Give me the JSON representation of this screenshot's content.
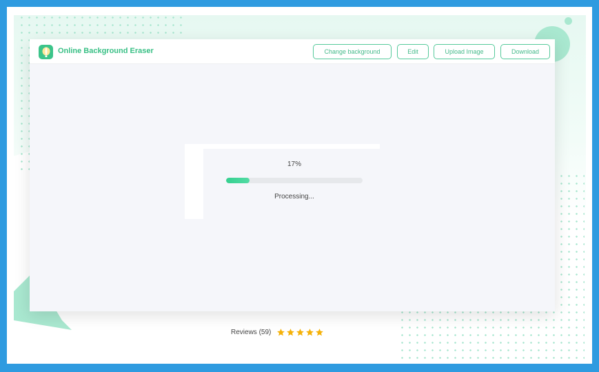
{
  "header": {
    "brand": "Online Background Eraser",
    "buttons": {
      "change_background": "Change background",
      "edit": "Edit",
      "upload_image": "Upload Image",
      "download": "Download"
    }
  },
  "processing": {
    "percent_label": "17%",
    "progress": 0.17,
    "status": "Processing..."
  },
  "reviews": {
    "label": "Reviews (59)",
    "stars": 5
  },
  "colors": {
    "accent": "#3cc48a",
    "frame": "#2f9be0",
    "star": "#f5b20a"
  },
  "icons": {
    "logo": "balloon-logo-icon",
    "star": "star-icon"
  }
}
